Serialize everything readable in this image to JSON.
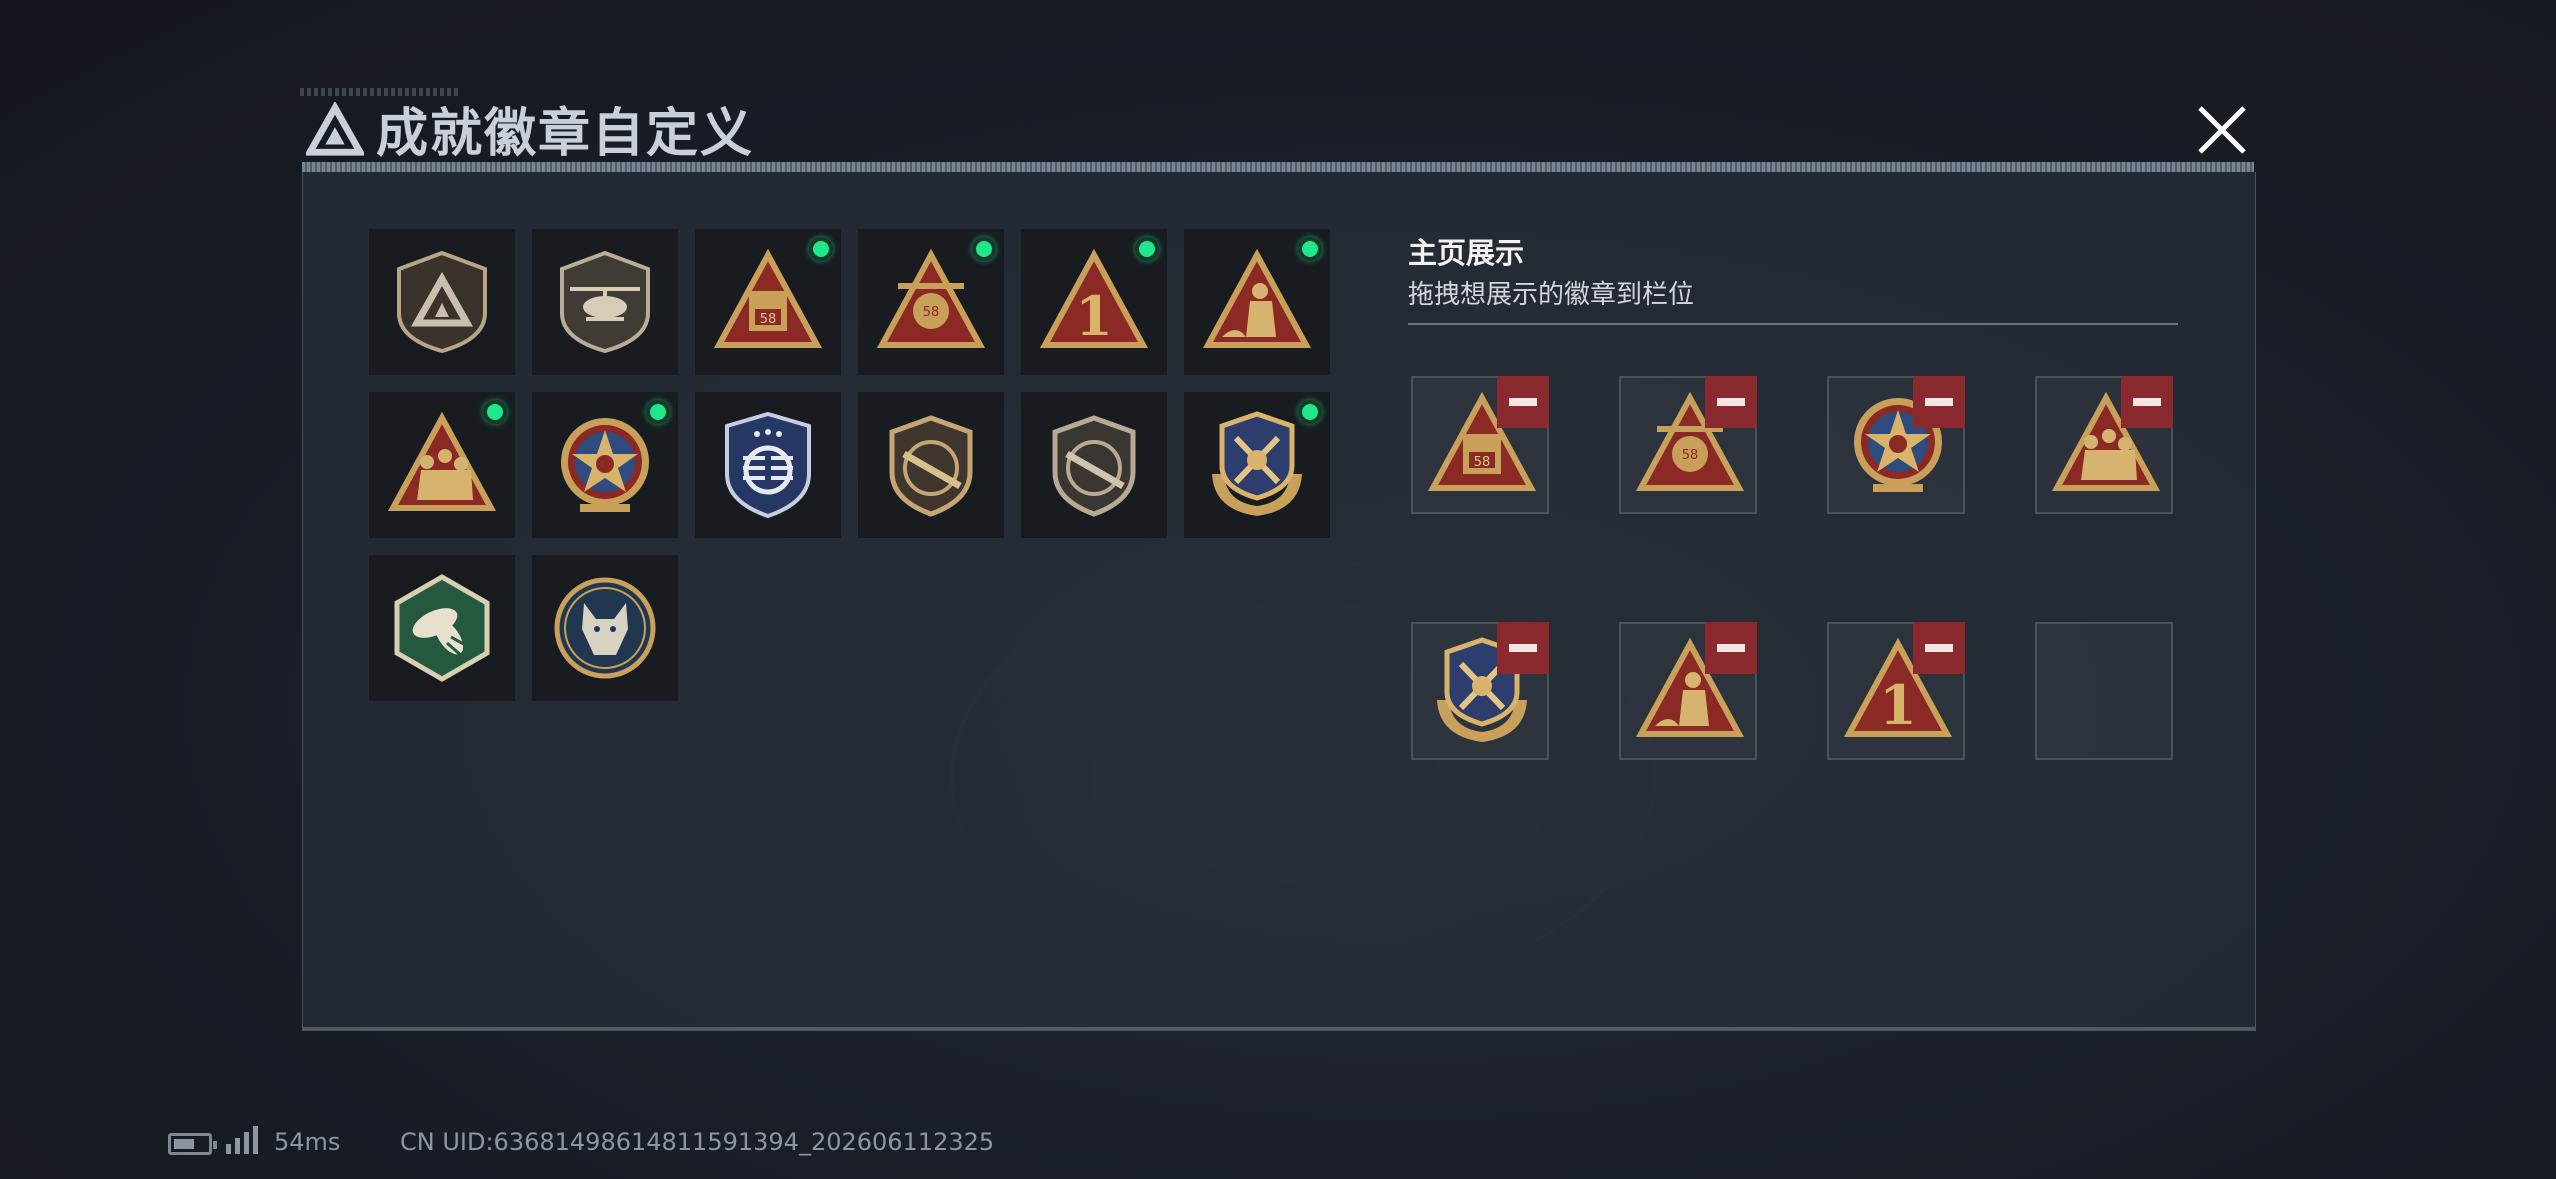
{
  "dialog": {
    "title": "成就徽章自定义",
    "close_icon": "close-icon"
  },
  "badges": [
    {
      "icon": "triangle-logo-shield-badge",
      "new": false
    },
    {
      "icon": "helicopter-shield-badge",
      "new": false
    },
    {
      "icon": "vehicle-58-triangle-badge",
      "new": true
    },
    {
      "icon": "turret-58-triangle-badge",
      "new": true
    },
    {
      "icon": "number-one-triangle-badge",
      "new": true
    },
    {
      "icon": "soldier-triangle-badge",
      "new": true
    },
    {
      "icon": "squad-triangle-badge",
      "new": true
    },
    {
      "icon": "star-medal-badge",
      "new": true
    },
    {
      "icon": "blue-wings-shield-badge",
      "new": false
    },
    {
      "icon": "rifle-shield-badge",
      "new": false
    },
    {
      "icon": "rifle-shield-badge-dark",
      "new": false
    },
    {
      "icon": "crossed-swords-laurel-badge",
      "new": true
    },
    {
      "icon": "hornet-hexagon-badge",
      "new": false
    },
    {
      "icon": "wolf-circle-badge",
      "new": false
    }
  ],
  "showcase": {
    "title": "主页展示",
    "subtitle": "拖拽想展示的徽章到栏位",
    "slots": [
      {
        "icon": "vehicle-58-triangle-badge"
      },
      {
        "icon": "turret-58-triangle-badge"
      },
      {
        "icon": "star-medal-badge"
      },
      {
        "icon": "squad-triangle-badge"
      },
      {
        "icon": "crossed-swords-laurel-badge"
      },
      {
        "icon": "soldier-triangle-badge"
      },
      {
        "icon": "number-one-triangle-badge"
      },
      {
        "icon": null
      }
    ]
  },
  "status_bar": {
    "ping": "54ms",
    "uid": "CN UID:63681498614811591394_202606112325"
  },
  "colors": {
    "new_dot": "#1ee88a",
    "remove_button": "#8a2a2e",
    "gold": "#c9a05a",
    "badge_red": "#8b2a24"
  }
}
